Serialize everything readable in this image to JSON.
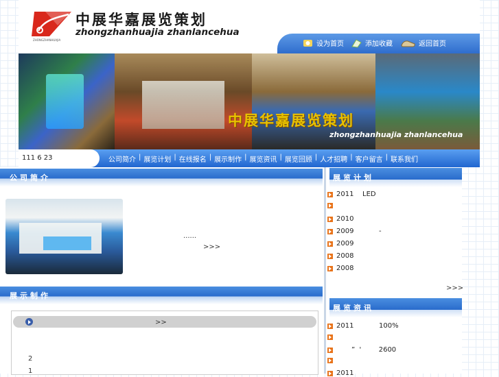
{
  "logo": {
    "cn": "中展华嘉展览策划",
    "en": "zhongzhanhuajia zhanlancehua",
    "small": "ZHONGZHANHUAJIA"
  },
  "toplinks": [
    {
      "icon": "home-set-icon",
      "label": "设为首页"
    },
    {
      "icon": "favorite-icon",
      "label": "添加收藏"
    },
    {
      "icon": "shoe-icon",
      "label": "返回首页"
    }
  ],
  "banner": {
    "cn": "中展华嘉展览策划",
    "en": "zhongzhanhuajia zhanlancehua"
  },
  "nav": {
    "date": "111 6 23",
    "items": [
      "公司简介",
      "展览计划",
      "在线报名",
      "展示制作",
      "展览资讯",
      "展览回顾",
      "人才招聘",
      "客户留言",
      "联系我们"
    ]
  },
  "about": {
    "title": "公司简介",
    "ellipsis": "......",
    "more": ">>>"
  },
  "plan": {
    "title": "展览计划",
    "items": [
      {
        "year": "2011",
        "text": "LED"
      },
      {
        "year": "",
        "text": ""
      },
      {
        "year": "2010",
        "text": ""
      },
      {
        "year": "2009",
        "text": "-"
      },
      {
        "year": "2009",
        "text": ""
      },
      {
        "year": "2008",
        "text": ""
      },
      {
        "year": "2008",
        "text": ""
      }
    ],
    "more": ">>>"
  },
  "display": {
    "title": "展示制作",
    "bar_more": ">>",
    "line1": "2",
    "line2": "1"
  },
  "news": {
    "title": "展览资讯",
    "items": [
      {
        "year": "2011",
        "text": "100%"
      },
      {
        "year": "",
        "text": ""
      },
      {
        "year": "",
        "text": "”  '        2600"
      },
      {
        "year": "",
        "text": ""
      },
      {
        "year": "2011",
        "text": ""
      }
    ]
  },
  "colors": {
    "nav_blue": "#2f6dcd",
    "accent_orange": "#e8731a",
    "banner_gold": "#e8c100",
    "logo_red": "#d9281c"
  }
}
